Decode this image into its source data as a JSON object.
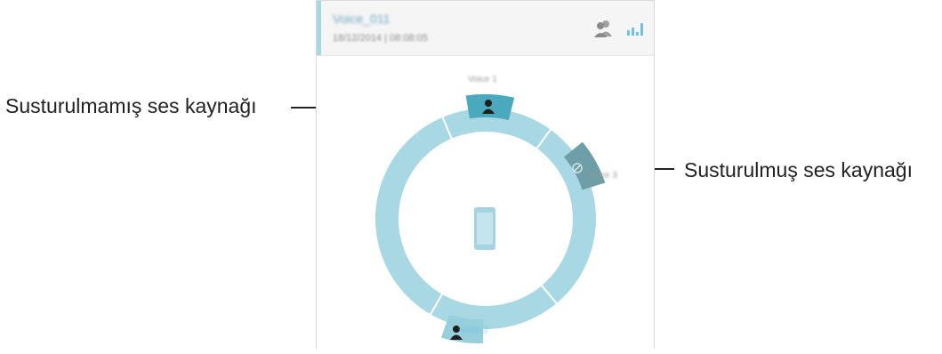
{
  "recording": {
    "name": "Voice_011",
    "datetime": "18/12/2014 | 08:08:05"
  },
  "header_icons": [
    "people-icon",
    "equalizer-icon"
  ],
  "speakers": [
    {
      "label": "Voice 1",
      "muted": false,
      "icon": "person-icon"
    },
    {
      "label": "Voice 3",
      "muted": true,
      "icon": "muted-icon"
    },
    {
      "label": "Voice 2",
      "muted": false,
      "icon": "person-icon"
    }
  ],
  "callouts": {
    "unmuted": "Susturulmamış ses kaynağı",
    "muted": "Susturulmuş ses kaynağı"
  },
  "colors": {
    "ring": "#a8d8e3",
    "active_segment": "#4aa9bd",
    "muted_segment": "#6e9ea7",
    "device": "#a6d3e3",
    "accent": "#a7d7e1"
  }
}
